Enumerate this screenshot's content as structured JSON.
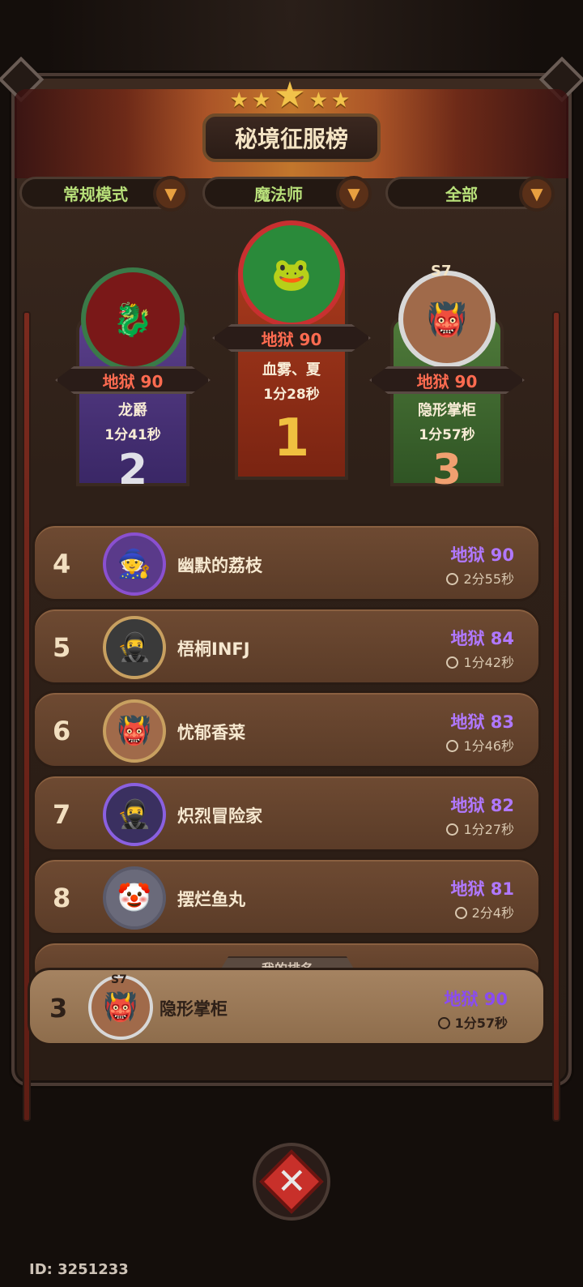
{
  "title": "秘境征服榜",
  "filters": {
    "mode": "常规模式",
    "class": "魔法师",
    "scope": "全部"
  },
  "podium": {
    "first": {
      "rank": "1",
      "level": "地狱 90",
      "name": "血雾、夏",
      "time": "1分28秒"
    },
    "second": {
      "rank": "2",
      "level": "地狱 90",
      "name": "龙爵",
      "time": "1分41秒"
    },
    "third": {
      "rank": "3",
      "level": "地狱 90",
      "name": "隐形掌柜",
      "time": "1分57秒",
      "season_badge": "S7"
    }
  },
  "list": [
    {
      "rank": "4",
      "name": "幽默的荔枝",
      "level": "地狱 90",
      "time": "2分55秒"
    },
    {
      "rank": "5",
      "name": "梧桐INFJ",
      "level": "地狱 84",
      "time": "1分42秒"
    },
    {
      "rank": "6",
      "name": "忧郁香菜",
      "level": "地狱 83",
      "time": "1分46秒"
    },
    {
      "rank": "7",
      "name": "炽烈冒险家",
      "level": "地狱 82",
      "time": "1分27秒"
    },
    {
      "rank": "8",
      "name": "摆烂鱼丸",
      "level": "地狱 81",
      "time": "2分4秒"
    }
  ],
  "my_rank": {
    "label": "我的排名",
    "rank": "3",
    "season_badge": "S7",
    "name": "隐形掌柜",
    "level": "地狱 90",
    "time": "1分57秒"
  },
  "footer": {
    "uid": "ID: 3251233"
  },
  "colors": {
    "level_purple": "#b078ff",
    "level_red": "#ff6b50",
    "filter_green": "#b8e07a",
    "gold": "#f1c24a"
  }
}
